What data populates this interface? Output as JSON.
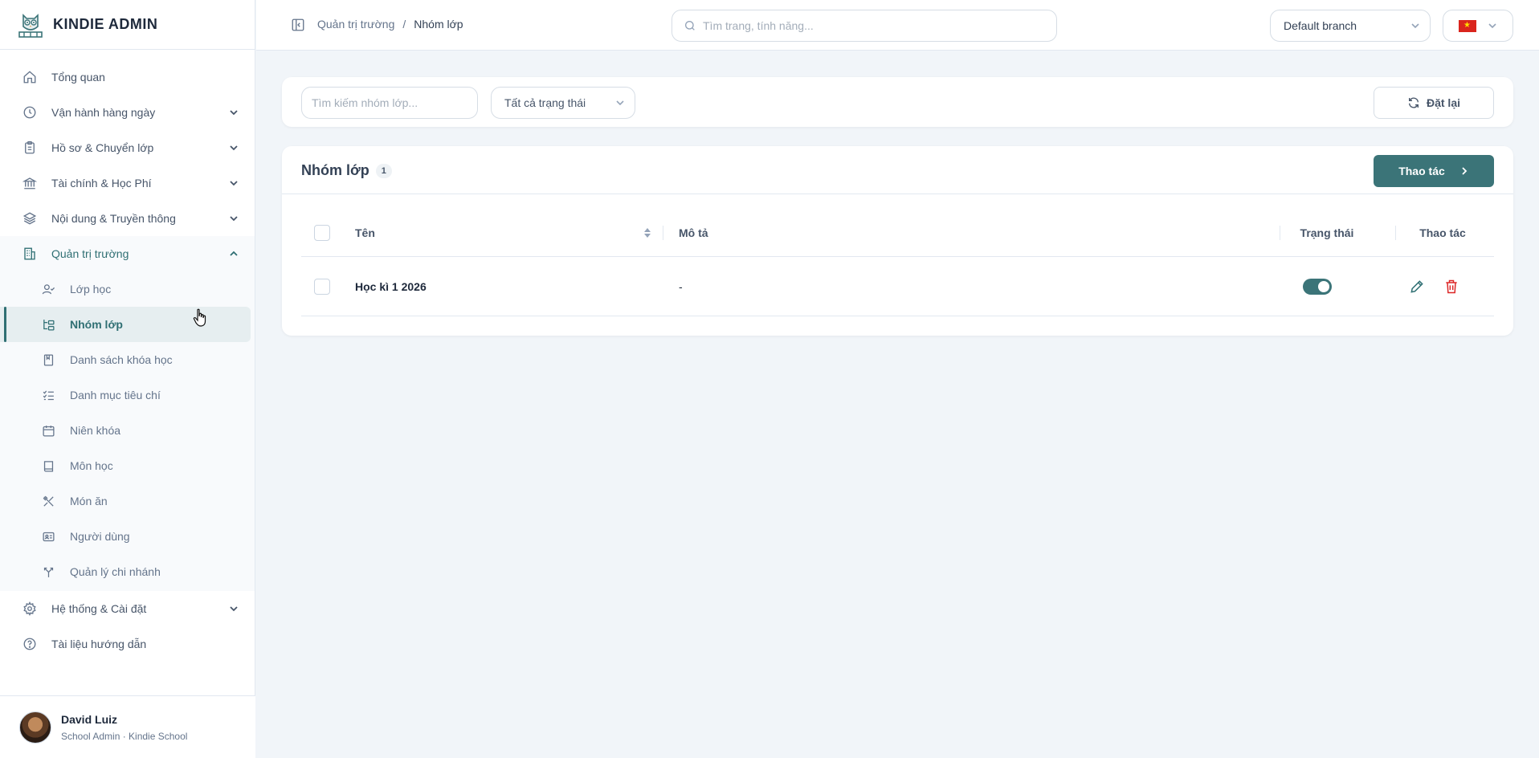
{
  "brand": {
    "title": "KINDIE ADMIN"
  },
  "sidebar": {
    "items": [
      {
        "label": "Tổng quan",
        "icon": "home-icon"
      },
      {
        "label": "Vận hành hàng ngày",
        "icon": "clock-icon"
      },
      {
        "label": "Hồ sơ & Chuyển lớp",
        "icon": "clipboard-icon"
      },
      {
        "label": "Tài chính & Học Phí",
        "icon": "bank-icon"
      },
      {
        "label": "Nội dung & Truyền thông",
        "icon": "layers-icon"
      },
      {
        "label": "Quản trị trường",
        "icon": "building-icon"
      }
    ],
    "subitems": [
      {
        "label": "Lớp học",
        "icon": "user-check-icon"
      },
      {
        "label": "Nhóm lớp",
        "icon": "group-tree-icon"
      },
      {
        "label": "Danh sách khóa học",
        "icon": "book-bookmark-icon"
      },
      {
        "label": "Danh mục tiêu chí",
        "icon": "checklist-icon"
      },
      {
        "label": "Niên khóa",
        "icon": "calendar-icon"
      },
      {
        "label": "Môn học",
        "icon": "book-icon"
      },
      {
        "label": "Món ăn",
        "icon": "utensils-icon"
      },
      {
        "label": "Người dùng",
        "icon": "id-card-icon"
      },
      {
        "label": "Quản lý chi nhánh",
        "icon": "branch-icon"
      }
    ],
    "bottom_items": [
      {
        "label": "Hệ thống & Cài đặt",
        "icon": "gear-icon"
      },
      {
        "label": "Tài liệu hướng dẫn",
        "icon": "help-icon"
      }
    ]
  },
  "user": {
    "name": "David Luiz",
    "role": "School Admin · Kindie School"
  },
  "topbar": {
    "breadcrumb": [
      "Quản trị trường",
      "/",
      "Nhóm lớp"
    ],
    "search_placeholder": "Tìm trang, tính năng...",
    "branch": "Default branch"
  },
  "filters": {
    "search_placeholder": "Tìm kiếm nhóm lớp...",
    "status": "Tất cả trạng thái",
    "reset_label": "Đặt lại"
  },
  "table": {
    "title": "Nhóm lớp",
    "count": "1",
    "actions_label": "Thao tác",
    "columns": {
      "name": "Tên",
      "desc": "Mô tả",
      "status": "Trạng thái",
      "actions": "Thao tác"
    },
    "rows": [
      {
        "name": "Học kì 1 2026",
        "desc": "-",
        "active": true
      }
    ]
  },
  "colors": {
    "accent": "#3b7478",
    "danger": "#dc2626"
  }
}
